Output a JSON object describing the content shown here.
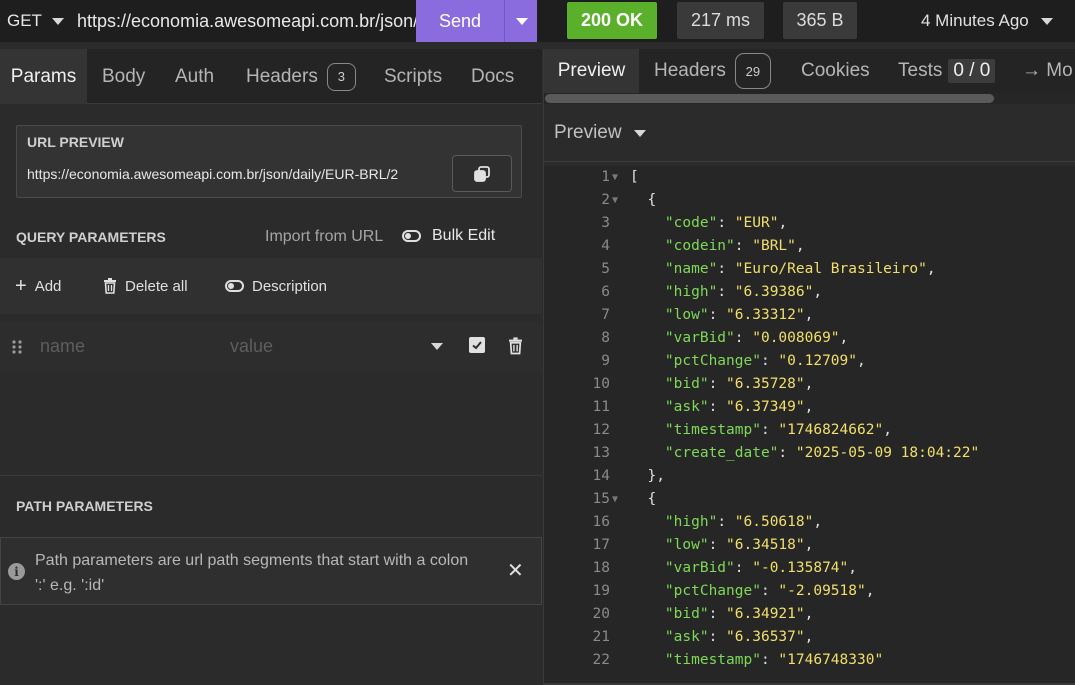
{
  "request": {
    "method": "GET",
    "url": "https://economia.awesomeapi.com.br/json/daily/EUR-BRL/2",
    "send_label": "Send"
  },
  "response_meta": {
    "status": "200 OK",
    "time": "217 ms",
    "size": "365 B",
    "ago": "4 Minutes Ago"
  },
  "left_tabs": [
    {
      "label": "Params"
    },
    {
      "label": "Body"
    },
    {
      "label": "Auth"
    },
    {
      "label": "Headers",
      "badge": "3"
    },
    {
      "label": "Scripts"
    },
    {
      "label": "Docs"
    }
  ],
  "url_preview": {
    "title": "URL PREVIEW",
    "value": "https://economia.awesomeapi.com.br/json/daily/EUR-BRL/2"
  },
  "query": {
    "title": "QUERY PARAMETERS",
    "import_label": "Import from URL",
    "bulk_label": "Bulk Edit",
    "add_label": "Add",
    "delete_all_label": "Delete all",
    "description_label": "Description",
    "name_placeholder": "name",
    "value_placeholder": "value"
  },
  "path": {
    "title": "PATH PARAMETERS",
    "info": "Path parameters are url path segments that start with a colon ':' e.g. ':id'"
  },
  "right_tabs": [
    {
      "label": "Preview"
    },
    {
      "label": "Headers",
      "badge": "29"
    },
    {
      "label": "Cookies"
    },
    {
      "label": "Tests",
      "badge": "0 / 0"
    },
    {
      "label": "→ Mo"
    }
  ],
  "preview_label": "Preview",
  "code_lines": [
    {
      "n": "1",
      "fold": true,
      "parts": [
        [
          "p",
          "["
        ]
      ]
    },
    {
      "n": "2",
      "fold": true,
      "parts": [
        [
          "p",
          "  {"
        ]
      ]
    },
    {
      "n": "3",
      "parts": [
        [
          "p",
          "    "
        ],
        [
          "k",
          "\"code\""
        ],
        [
          "p",
          ": "
        ],
        [
          "s",
          "\"EUR\""
        ],
        [
          "p",
          ","
        ]
      ]
    },
    {
      "n": "4",
      "parts": [
        [
          "p",
          "    "
        ],
        [
          "k",
          "\"codein\""
        ],
        [
          "p",
          ": "
        ],
        [
          "s",
          "\"BRL\""
        ],
        [
          "p",
          ","
        ]
      ]
    },
    {
      "n": "5",
      "parts": [
        [
          "p",
          "    "
        ],
        [
          "k",
          "\"name\""
        ],
        [
          "p",
          ": "
        ],
        [
          "s",
          "\"Euro/Real Brasileiro\""
        ],
        [
          "p",
          ","
        ]
      ]
    },
    {
      "n": "6",
      "parts": [
        [
          "p",
          "    "
        ],
        [
          "k",
          "\"high\""
        ],
        [
          "p",
          ": "
        ],
        [
          "s",
          "\"6.39386\""
        ],
        [
          "p",
          ","
        ]
      ]
    },
    {
      "n": "7",
      "parts": [
        [
          "p",
          "    "
        ],
        [
          "k",
          "\"low\""
        ],
        [
          "p",
          ": "
        ],
        [
          "s",
          "\"6.33312\""
        ],
        [
          "p",
          ","
        ]
      ]
    },
    {
      "n": "8",
      "parts": [
        [
          "p",
          "    "
        ],
        [
          "k",
          "\"varBid\""
        ],
        [
          "p",
          ": "
        ],
        [
          "s",
          "\"0.008069\""
        ],
        [
          "p",
          ","
        ]
      ]
    },
    {
      "n": "9",
      "parts": [
        [
          "p",
          "    "
        ],
        [
          "k",
          "\"pctChange\""
        ],
        [
          "p",
          ": "
        ],
        [
          "s",
          "\"0.12709\""
        ],
        [
          "p",
          ","
        ]
      ]
    },
    {
      "n": "10",
      "parts": [
        [
          "p",
          "    "
        ],
        [
          "k",
          "\"bid\""
        ],
        [
          "p",
          ": "
        ],
        [
          "s",
          "\"6.35728\""
        ],
        [
          "p",
          ","
        ]
      ]
    },
    {
      "n": "11",
      "parts": [
        [
          "p",
          "    "
        ],
        [
          "k",
          "\"ask\""
        ],
        [
          "p",
          ": "
        ],
        [
          "s",
          "\"6.37349\""
        ],
        [
          "p",
          ","
        ]
      ]
    },
    {
      "n": "12",
      "parts": [
        [
          "p",
          "    "
        ],
        [
          "k",
          "\"timestamp\""
        ],
        [
          "p",
          ": "
        ],
        [
          "s",
          "\"1746824662\""
        ],
        [
          "p",
          ","
        ]
      ]
    },
    {
      "n": "13",
      "parts": [
        [
          "p",
          "    "
        ],
        [
          "k",
          "\"create_date\""
        ],
        [
          "p",
          ": "
        ],
        [
          "s",
          "\"2025-05-09 18:04:22\""
        ]
      ]
    },
    {
      "n": "14",
      "parts": [
        [
          "p",
          "  },"
        ]
      ]
    },
    {
      "n": "15",
      "fold": true,
      "parts": [
        [
          "p",
          "  {"
        ]
      ]
    },
    {
      "n": "16",
      "parts": [
        [
          "p",
          "    "
        ],
        [
          "k",
          "\"high\""
        ],
        [
          "p",
          ": "
        ],
        [
          "s",
          "\"6.50618\""
        ],
        [
          "p",
          ","
        ]
      ]
    },
    {
      "n": "17",
      "parts": [
        [
          "p",
          "    "
        ],
        [
          "k",
          "\"low\""
        ],
        [
          "p",
          ": "
        ],
        [
          "s",
          "\"6.34518\""
        ],
        [
          "p",
          ","
        ]
      ]
    },
    {
      "n": "18",
      "parts": [
        [
          "p",
          "    "
        ],
        [
          "k",
          "\"varBid\""
        ],
        [
          "p",
          ": "
        ],
        [
          "s",
          "\"-0.135874\""
        ],
        [
          "p",
          ","
        ]
      ]
    },
    {
      "n": "19",
      "parts": [
        [
          "p",
          "    "
        ],
        [
          "k",
          "\"pctChange\""
        ],
        [
          "p",
          ": "
        ],
        [
          "s",
          "\"-2.09518\""
        ],
        [
          "p",
          ","
        ]
      ]
    },
    {
      "n": "20",
      "parts": [
        [
          "p",
          "    "
        ],
        [
          "k",
          "\"bid\""
        ],
        [
          "p",
          ": "
        ],
        [
          "s",
          "\"6.34921\""
        ],
        [
          "p",
          ","
        ]
      ]
    },
    {
      "n": "21",
      "parts": [
        [
          "p",
          "    "
        ],
        [
          "k",
          "\"ask\""
        ],
        [
          "p",
          ": "
        ],
        [
          "s",
          "\"6.36537\""
        ],
        [
          "p",
          ","
        ]
      ]
    },
    {
      "n": "22",
      "parts": [
        [
          "p",
          "    "
        ],
        [
          "k",
          "\"timestamp\""
        ],
        [
          "p",
          ": "
        ],
        [
          "s",
          "\"1746748330\""
        ]
      ]
    }
  ],
  "colors": {
    "send": "#8b6cdf",
    "status_ok": "#5ab02a",
    "json_key": "#7ed957",
    "json_string": "#f2df6b"
  }
}
